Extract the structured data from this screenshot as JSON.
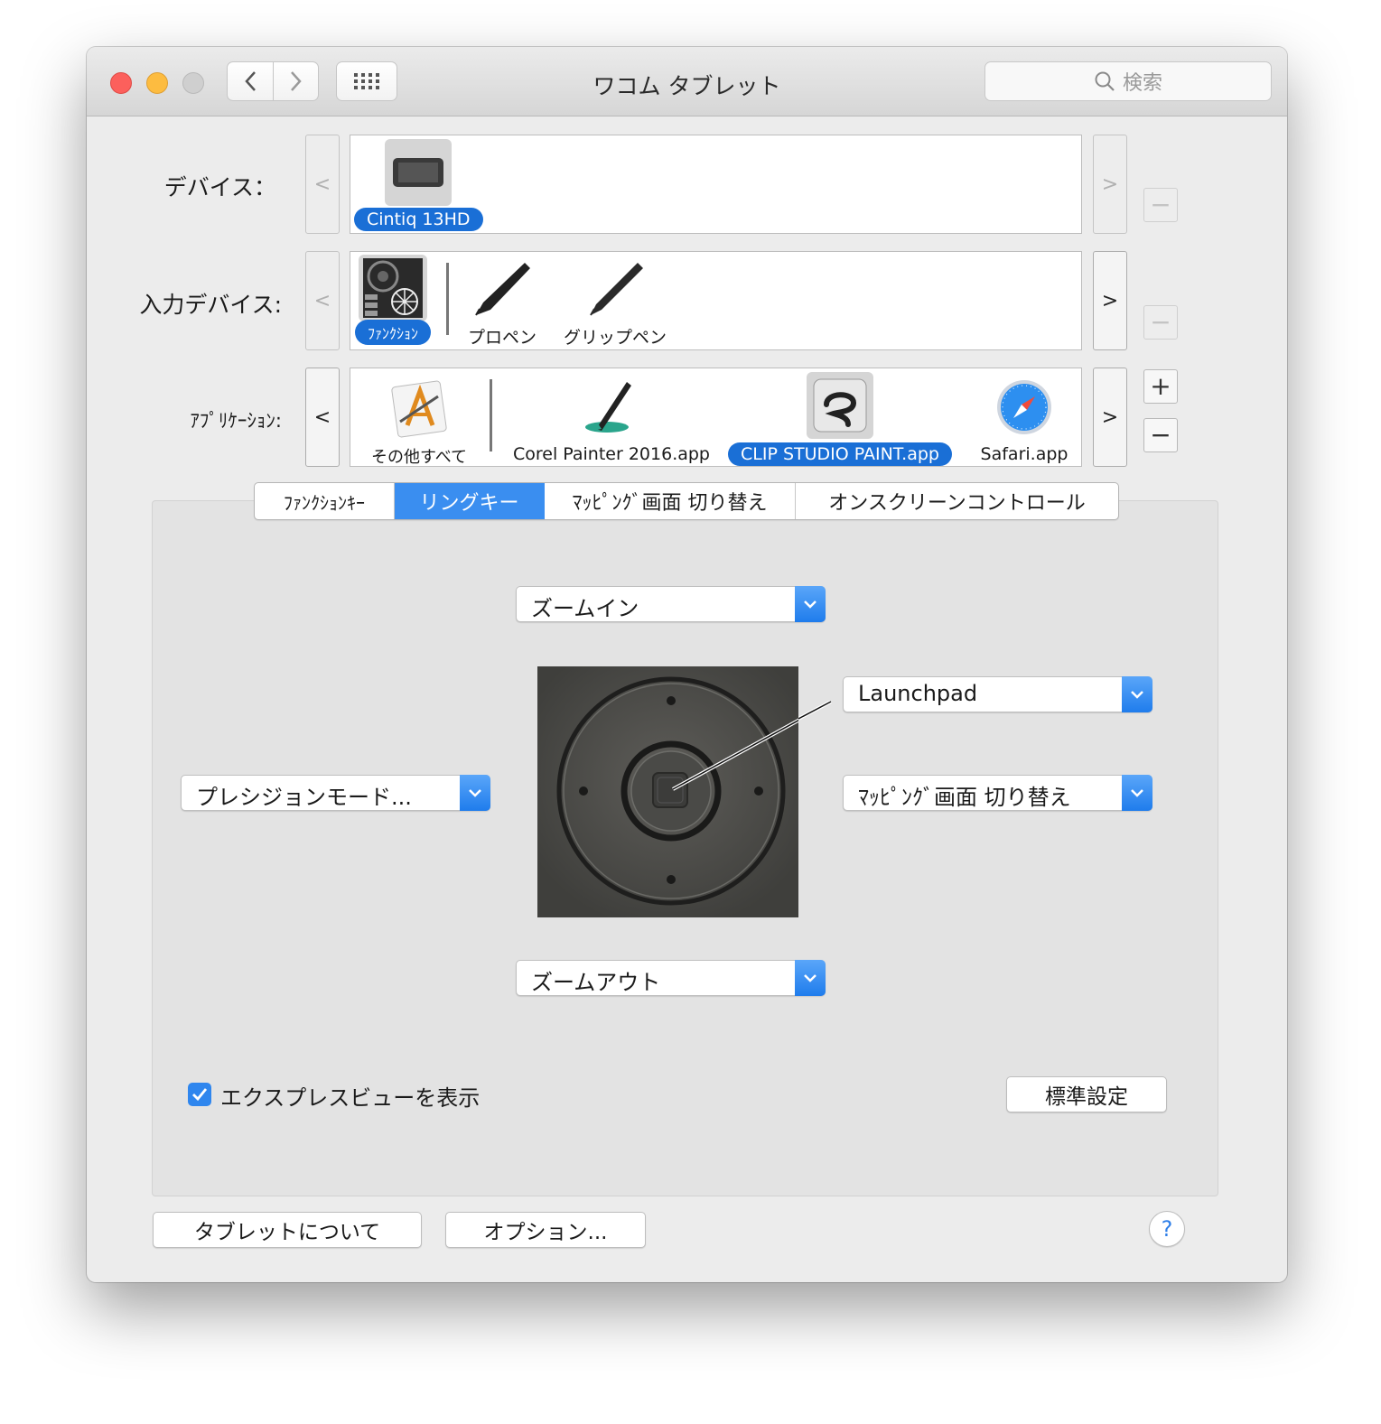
{
  "window": {
    "title": "ワコム タブレット",
    "search_placeholder": "検索"
  },
  "device_row": {
    "label": "デバイス：",
    "prev": "<",
    "next": ">",
    "remove": "−",
    "items": [
      {
        "label": "Cintiq 13HD",
        "selected": true
      }
    ]
  },
  "input_row": {
    "label": "入力デバイス:",
    "prev": "<",
    "next": ">",
    "remove": "−",
    "items": [
      {
        "label": "ﾌｧﾝｸｼｮﾝ",
        "selected": true
      },
      {
        "label": "プロペン",
        "selected": false
      },
      {
        "label": "グリップペン",
        "selected": false
      }
    ]
  },
  "app_row": {
    "label": "ｱﾌﾟﾘｹｰｼｮﾝ:",
    "prev": "<",
    "next": ">",
    "add": "+",
    "remove": "−",
    "items": [
      {
        "label": "その他すべて",
        "selected": false
      },
      {
        "label": "Corel Painter 2016.app",
        "selected": false
      },
      {
        "label": "CLIP STUDIO PAINT.app",
        "selected": true
      },
      {
        "label": "Safari.app",
        "selected": false
      }
    ]
  },
  "tabs": [
    {
      "label": "ﾌｧﾝｸｼｮﾝｷｰ",
      "active": false
    },
    {
      "label": "リングキー",
      "active": true
    },
    {
      "label": "ﾏｯﾋﾟﾝｸﾞ画面 切り替え",
      "active": false
    },
    {
      "label": "オンスクリーンコントロール",
      "active": false
    }
  ],
  "ring": {
    "top": "ズームイン",
    "bottom": "ズームアウト",
    "left": "プレシジョンモード...",
    "right_center": "ﾏｯﾋﾟﾝｸﾞ画面 切り替え",
    "center_button": "Launchpad"
  },
  "express_view": {
    "label": "エクスプレスビューを表示",
    "checked": true
  },
  "buttons": {
    "defaults": "標準設定",
    "about": "タブレットについて",
    "options": "オプション...",
    "help": "?"
  },
  "colors": {
    "accent": "#1a6fd6",
    "tab_active": "#3a8ef0"
  }
}
